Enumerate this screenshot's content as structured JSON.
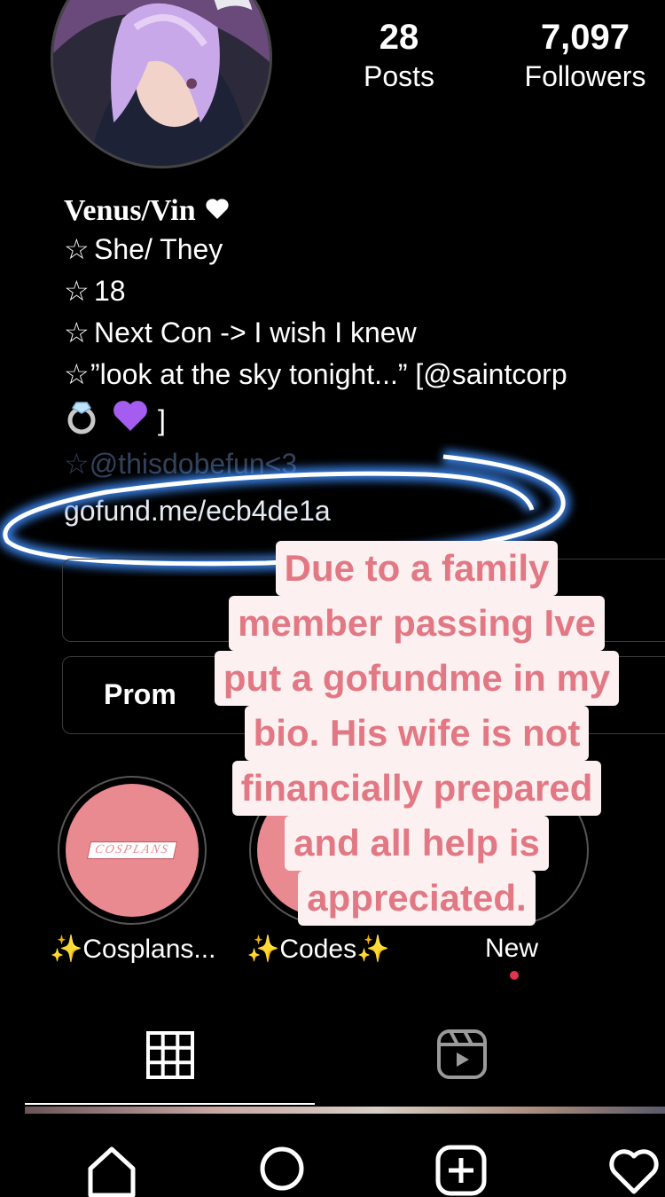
{
  "profile": {
    "avatar_icon": "avatar-illustration",
    "stats": [
      {
        "value": "28",
        "label": "Posts"
      },
      {
        "value": "7,097",
        "label": "Followers"
      }
    ]
  },
  "bio": {
    "name": "Venus/Vin",
    "lines": [
      "She/ They",
      "18",
      "Next Con -> I wish I knew",
      "”look at the sky tonight...” [@saintcorp"
    ],
    "emoji_line_end": "]",
    "partial_line": "☆@thisdobefun<3",
    "link": "gofund.me/ecb4de1a"
  },
  "buttons": {
    "promotions_label": "Prom"
  },
  "caption": {
    "lines": [
      "Due to a family",
      "member passing Ive",
      "put a gofundme in my",
      "bio. His wife is not",
      "financially prepared",
      "and all help is",
      "appreciated."
    ]
  },
  "highlights": [
    {
      "label": "Cosplans...",
      "cover_text": "COSPLANS",
      "sparkles": "✨"
    },
    {
      "label": "Codes",
      "sparkles": "✨"
    },
    {
      "label": "New"
    }
  ],
  "colors": {
    "caption_text": "#e27883",
    "caption_bg": "#fdf0f1",
    "highlight_fill": "#e98a91",
    "link_glow": "#9fd0ff"
  }
}
